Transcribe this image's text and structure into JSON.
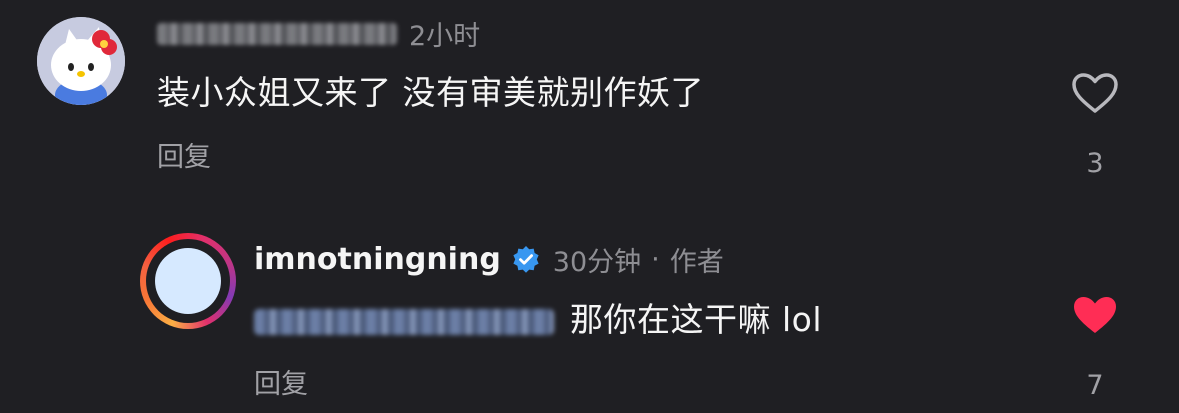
{
  "comments": [
    {
      "username_obscured": "_milkybunss??",
      "time": "2小时",
      "text": "装小众姐又来了 没有审美就别作妖了",
      "reply_label": "回复",
      "like_count": "3",
      "liked": false
    }
  ],
  "reply": {
    "username": "imnotningning",
    "verified": true,
    "time": "30分钟",
    "separator": "·",
    "author_tag": "作者",
    "mention_obscured": "@_milkybunss??",
    "text": "那你在这干嘛 lol",
    "reply_label": "回复",
    "like_count": "7",
    "liked": true
  },
  "colors": {
    "background": "#1f1f23",
    "like_active": "#ff2d55",
    "verified": "#3897f0",
    "muted_text": "#8e8e93"
  },
  "icons": {
    "like_outline": "heart-outline-icon",
    "like_filled": "heart-filled-icon",
    "verified_badge": "verified-badge-icon"
  }
}
